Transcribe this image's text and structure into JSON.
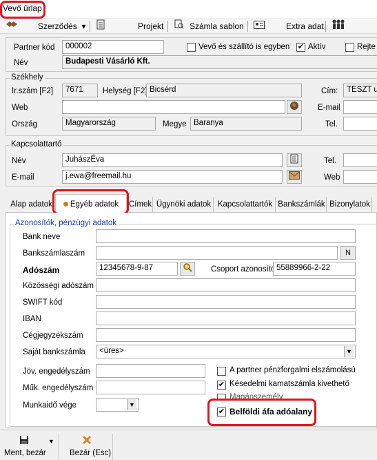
{
  "window": {
    "title": "Vevő űrlap"
  },
  "toolbar": {
    "contracts": "Szerződés",
    "project": "Projekt",
    "invoice_template": "Számla sablon",
    "extra_data": "Extra adat"
  },
  "header": {
    "partner_code_label": "Partner kód",
    "partner_code": "000002",
    "buyer_shipper_label": "Vevő és szállító is egyben",
    "active_label": "Aktív",
    "hidden_label": "Rejte",
    "name_label": "Név",
    "name": "Budapesti Vásárló Kft."
  },
  "seat": {
    "group_title": "Székhely",
    "zip_label": "Ir.szám [F2]",
    "zip": "7671",
    "city_label": "Helység [F2]",
    "city": "Bicsérd",
    "address_label": "Cím:",
    "address": "TESZT utca",
    "web_label": "Web",
    "web": "",
    "email_label": "E-mail",
    "country_label": "Ország",
    "country": "Magyarország",
    "county_label": "Megye",
    "county": "Baranya",
    "phone_label": "Tel."
  },
  "contact": {
    "group_title": "Kapcsolattartó",
    "name_label": "Név",
    "name": "JuhászÉva",
    "phone_label": "Tel.",
    "email_label": "E-mail",
    "email": "j.ewa@freemail.hu",
    "web_label": "Web"
  },
  "tabs": [
    {
      "label": "Alap adatok"
    },
    {
      "label": "Egyéb adatok"
    },
    {
      "label": "Címek"
    },
    {
      "label": "Ügynöki adatok"
    },
    {
      "label": "Kapcsolattartók"
    },
    {
      "label": "Bankszámlák"
    },
    {
      "label": "Bizonylatok"
    }
  ],
  "other": {
    "group_title": "Azonosítók, pénzügyi adatok",
    "bank_name_label": "Bank neve",
    "bank_account_label": "Bankszámlaszám",
    "n_button": "N",
    "tax_number_label": "Adószám",
    "tax_number": "12345678-9-87",
    "group_id_label": "Csoport azonosító",
    "group_id": "55889966-2-22",
    "eu_tax_label": "Közösségi adószám",
    "swift_label": "SWIFT kód",
    "iban_label": "IBAN",
    "company_reg_label": "Cégjegyzékszám",
    "own_account_label": "Saját bankszámla",
    "own_account_value": "<üres>",
    "future_permit_label": "Jöv. engedélyszám",
    "op_permit_label": "Műk. engedélyszám",
    "worktime_end_label": "Munkaidő vége",
    "cash_flow_label": "A partner pénzforgalmi elszámolású",
    "late_interest_label": "Késedelmi kamatszámla kivethető",
    "private_person_label": "Magánszemély",
    "domestic_vat_label": "Belföldi áfa adóalany"
  },
  "bottom": {
    "save_close": "Ment, bezár",
    "close": "Bezár (Esc)"
  },
  "colors": {
    "highlight": "#e0141e",
    "group_title_blue": "#1a3fa8"
  }
}
